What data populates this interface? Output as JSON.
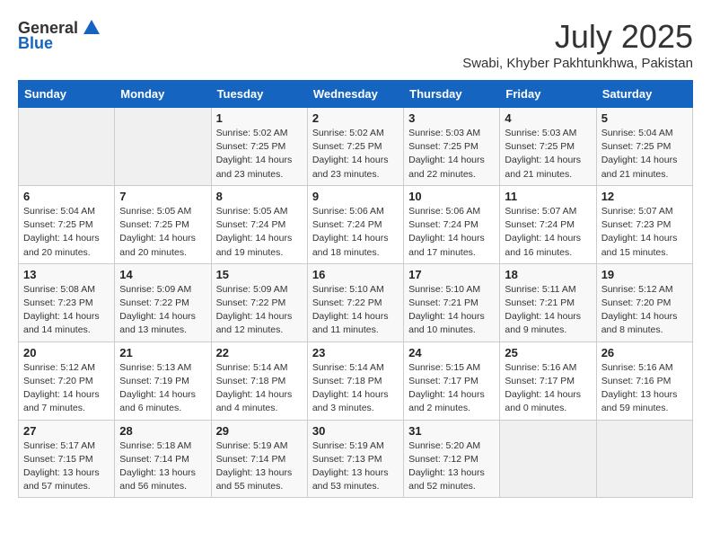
{
  "header": {
    "logo_general": "General",
    "logo_blue": "Blue",
    "month_title": "July 2025",
    "location": "Swabi, Khyber Pakhtunkhwa, Pakistan"
  },
  "weekdays": [
    "Sunday",
    "Monday",
    "Tuesday",
    "Wednesday",
    "Thursday",
    "Friday",
    "Saturday"
  ],
  "weeks": [
    [
      {
        "day": "",
        "sunrise": "",
        "sunset": "",
        "daylight": "",
        "empty": true
      },
      {
        "day": "",
        "sunrise": "",
        "sunset": "",
        "daylight": "",
        "empty": true
      },
      {
        "day": "1",
        "sunrise": "Sunrise: 5:02 AM",
        "sunset": "Sunset: 7:25 PM",
        "daylight": "Daylight: 14 hours and 23 minutes."
      },
      {
        "day": "2",
        "sunrise": "Sunrise: 5:02 AM",
        "sunset": "Sunset: 7:25 PM",
        "daylight": "Daylight: 14 hours and 23 minutes."
      },
      {
        "day": "3",
        "sunrise": "Sunrise: 5:03 AM",
        "sunset": "Sunset: 7:25 PM",
        "daylight": "Daylight: 14 hours and 22 minutes."
      },
      {
        "day": "4",
        "sunrise": "Sunrise: 5:03 AM",
        "sunset": "Sunset: 7:25 PM",
        "daylight": "Daylight: 14 hours and 21 minutes."
      },
      {
        "day": "5",
        "sunrise": "Sunrise: 5:04 AM",
        "sunset": "Sunset: 7:25 PM",
        "daylight": "Daylight: 14 hours and 21 minutes."
      }
    ],
    [
      {
        "day": "6",
        "sunrise": "Sunrise: 5:04 AM",
        "sunset": "Sunset: 7:25 PM",
        "daylight": "Daylight: 14 hours and 20 minutes."
      },
      {
        "day": "7",
        "sunrise": "Sunrise: 5:05 AM",
        "sunset": "Sunset: 7:25 PM",
        "daylight": "Daylight: 14 hours and 20 minutes."
      },
      {
        "day": "8",
        "sunrise": "Sunrise: 5:05 AM",
        "sunset": "Sunset: 7:24 PM",
        "daylight": "Daylight: 14 hours and 19 minutes."
      },
      {
        "day": "9",
        "sunrise": "Sunrise: 5:06 AM",
        "sunset": "Sunset: 7:24 PM",
        "daylight": "Daylight: 14 hours and 18 minutes."
      },
      {
        "day": "10",
        "sunrise": "Sunrise: 5:06 AM",
        "sunset": "Sunset: 7:24 PM",
        "daylight": "Daylight: 14 hours and 17 minutes."
      },
      {
        "day": "11",
        "sunrise": "Sunrise: 5:07 AM",
        "sunset": "Sunset: 7:24 PM",
        "daylight": "Daylight: 14 hours and 16 minutes."
      },
      {
        "day": "12",
        "sunrise": "Sunrise: 5:07 AM",
        "sunset": "Sunset: 7:23 PM",
        "daylight": "Daylight: 14 hours and 15 minutes."
      }
    ],
    [
      {
        "day": "13",
        "sunrise": "Sunrise: 5:08 AM",
        "sunset": "Sunset: 7:23 PM",
        "daylight": "Daylight: 14 hours and 14 minutes."
      },
      {
        "day": "14",
        "sunrise": "Sunrise: 5:09 AM",
        "sunset": "Sunset: 7:22 PM",
        "daylight": "Daylight: 14 hours and 13 minutes."
      },
      {
        "day": "15",
        "sunrise": "Sunrise: 5:09 AM",
        "sunset": "Sunset: 7:22 PM",
        "daylight": "Daylight: 14 hours and 12 minutes."
      },
      {
        "day": "16",
        "sunrise": "Sunrise: 5:10 AM",
        "sunset": "Sunset: 7:22 PM",
        "daylight": "Daylight: 14 hours and 11 minutes."
      },
      {
        "day": "17",
        "sunrise": "Sunrise: 5:10 AM",
        "sunset": "Sunset: 7:21 PM",
        "daylight": "Daylight: 14 hours and 10 minutes."
      },
      {
        "day": "18",
        "sunrise": "Sunrise: 5:11 AM",
        "sunset": "Sunset: 7:21 PM",
        "daylight": "Daylight: 14 hours and 9 minutes."
      },
      {
        "day": "19",
        "sunrise": "Sunrise: 5:12 AM",
        "sunset": "Sunset: 7:20 PM",
        "daylight": "Daylight: 14 hours and 8 minutes."
      }
    ],
    [
      {
        "day": "20",
        "sunrise": "Sunrise: 5:12 AM",
        "sunset": "Sunset: 7:20 PM",
        "daylight": "Daylight: 14 hours and 7 minutes."
      },
      {
        "day": "21",
        "sunrise": "Sunrise: 5:13 AM",
        "sunset": "Sunset: 7:19 PM",
        "daylight": "Daylight: 14 hours and 6 minutes."
      },
      {
        "day": "22",
        "sunrise": "Sunrise: 5:14 AM",
        "sunset": "Sunset: 7:18 PM",
        "daylight": "Daylight: 14 hours and 4 minutes."
      },
      {
        "day": "23",
        "sunrise": "Sunrise: 5:14 AM",
        "sunset": "Sunset: 7:18 PM",
        "daylight": "Daylight: 14 hours and 3 minutes."
      },
      {
        "day": "24",
        "sunrise": "Sunrise: 5:15 AM",
        "sunset": "Sunset: 7:17 PM",
        "daylight": "Daylight: 14 hours and 2 minutes."
      },
      {
        "day": "25",
        "sunrise": "Sunrise: 5:16 AM",
        "sunset": "Sunset: 7:17 PM",
        "daylight": "Daylight: 14 hours and 0 minutes."
      },
      {
        "day": "26",
        "sunrise": "Sunrise: 5:16 AM",
        "sunset": "Sunset: 7:16 PM",
        "daylight": "Daylight: 13 hours and 59 minutes."
      }
    ],
    [
      {
        "day": "27",
        "sunrise": "Sunrise: 5:17 AM",
        "sunset": "Sunset: 7:15 PM",
        "daylight": "Daylight: 13 hours and 57 minutes."
      },
      {
        "day": "28",
        "sunrise": "Sunrise: 5:18 AM",
        "sunset": "Sunset: 7:14 PM",
        "daylight": "Daylight: 13 hours and 56 minutes."
      },
      {
        "day": "29",
        "sunrise": "Sunrise: 5:19 AM",
        "sunset": "Sunset: 7:14 PM",
        "daylight": "Daylight: 13 hours and 55 minutes."
      },
      {
        "day": "30",
        "sunrise": "Sunrise: 5:19 AM",
        "sunset": "Sunset: 7:13 PM",
        "daylight": "Daylight: 13 hours and 53 minutes."
      },
      {
        "day": "31",
        "sunrise": "Sunrise: 5:20 AM",
        "sunset": "Sunset: 7:12 PM",
        "daylight": "Daylight: 13 hours and 52 minutes."
      },
      {
        "day": "",
        "sunrise": "",
        "sunset": "",
        "daylight": "",
        "empty": true
      },
      {
        "day": "",
        "sunrise": "",
        "sunset": "",
        "daylight": "",
        "empty": true
      }
    ]
  ]
}
